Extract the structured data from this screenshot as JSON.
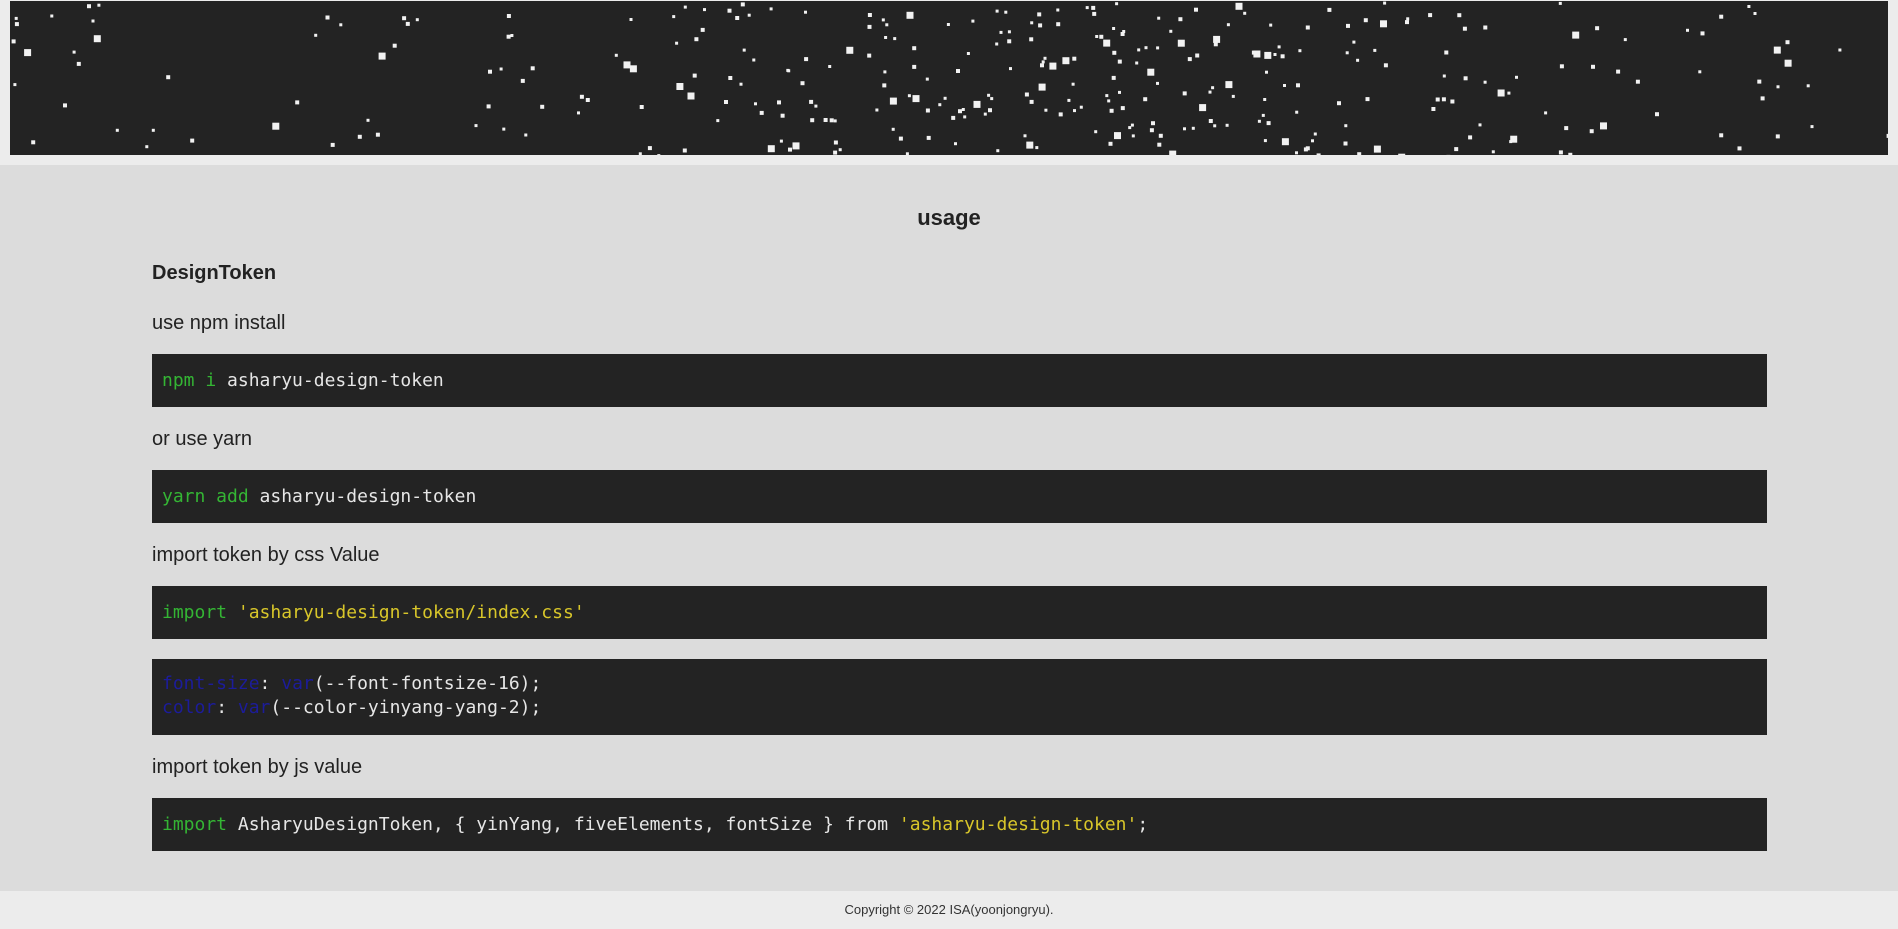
{
  "heading": "usage",
  "section_title": "DesignToken",
  "labels": {
    "npm": "use npm install",
    "yarn": "or use yarn",
    "css": "import token by css Value",
    "js": "import token by js value"
  },
  "code": {
    "npm": {
      "cmd": "npm i",
      "arg": "asharyu-design-token"
    },
    "yarn": {
      "cmd": "yarn add",
      "arg": "asharyu-design-token"
    },
    "css_import": {
      "kw": "import",
      "path": "'asharyu-design-token/index.css'"
    },
    "css_usage": [
      {
        "prop": "font-size",
        "fn": "var",
        "arg": "(--font-fontsize-16);"
      },
      {
        "prop": "color",
        "fn": "var",
        "arg": "(--color-yinyang-yang-2);"
      }
    ],
    "js_import": {
      "kw": "import",
      "body": " AsharyuDesignToken, { yinYang, fiveElements, fontSize } from ",
      "path": "'asharyu-design-token'",
      "end": ";"
    }
  },
  "footer": "Copyright © 2022 ISA(yoonjongryu).",
  "colors": {
    "banner_bg": "#232323",
    "content_bg": "#dcdcdc",
    "code_bg": "#232323",
    "keyword": "#34b534",
    "string": "#d8c62a",
    "css_prop": "#1c1c9a"
  }
}
